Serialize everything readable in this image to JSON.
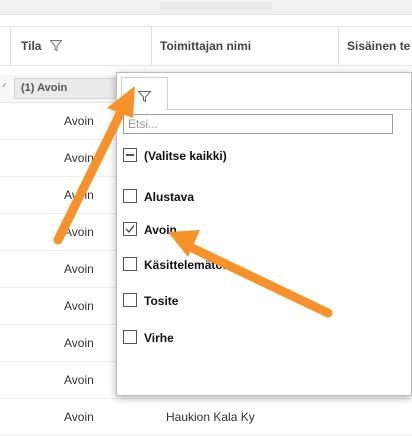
{
  "columns": {
    "status": "Tila",
    "supplier_name": "Toimittajan nimi",
    "internal": "Sisäinen te"
  },
  "filter_chip": "(1) Avoin",
  "rows": [
    {
      "status": "Avoin",
      "supplier": ""
    },
    {
      "status": "Avoin",
      "supplier": ""
    },
    {
      "status": "Avoin",
      "supplier": ""
    },
    {
      "status": "Avoin",
      "supplier": ""
    },
    {
      "status": "Avoin",
      "supplier": ""
    },
    {
      "status": "Avoin",
      "supplier": ""
    },
    {
      "status": "Avoin",
      "supplier": ""
    },
    {
      "status": "Avoin",
      "supplier": ""
    },
    {
      "status": "Avoin",
      "supplier": "Haukion Kala Ky"
    }
  ],
  "filter_popup": {
    "search_placeholder": "Etsi...",
    "select_all": "(Valitse kaikki)",
    "options": [
      {
        "label": "Alustava",
        "checked": false
      },
      {
        "label": "Avoin",
        "checked": true
      },
      {
        "label": "Käsittelemätön",
        "checked": false
      },
      {
        "label": "Tosite",
        "checked": false
      },
      {
        "label": "Virhe",
        "checked": false
      }
    ]
  },
  "colors": {
    "annotation_arrow": "#f7922b",
    "popup_border": "#bdbdbd"
  },
  "icons": {
    "filter": "filter-funnel-icon",
    "checkmark": "check-icon"
  }
}
